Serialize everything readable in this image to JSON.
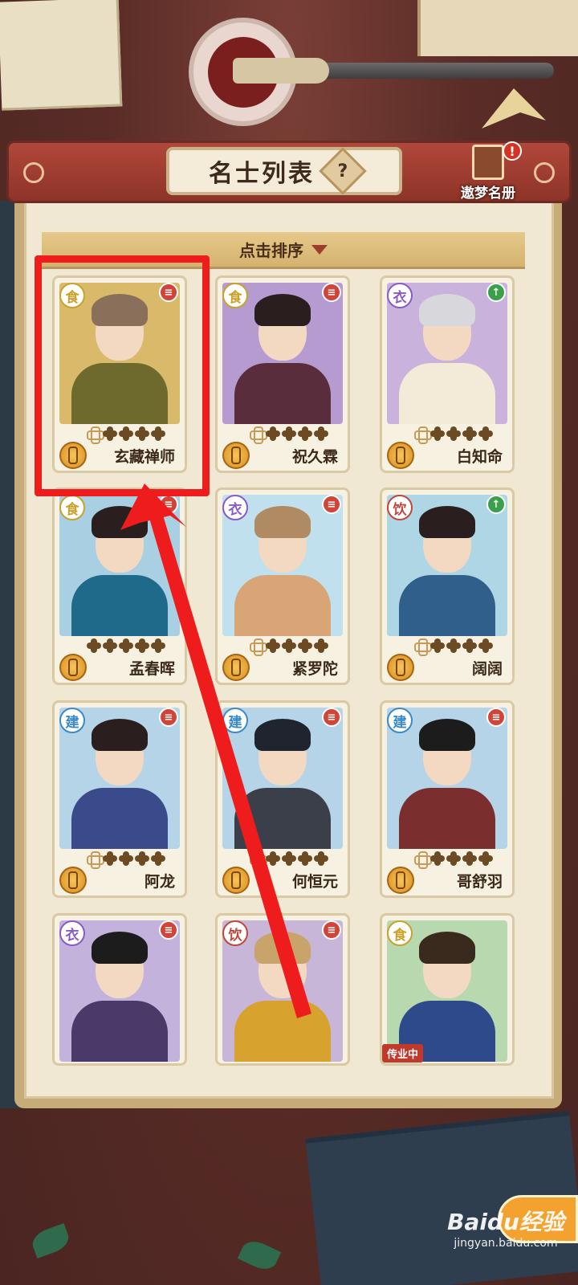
{
  "header": {
    "title": "名士列表",
    "help_label": "?",
    "dream_book_label": "遨梦名册",
    "alert_label": "!"
  },
  "sort": {
    "label": "点击排序"
  },
  "cards": [
    {
      "name": "玄藏禅师",
      "category": "食",
      "category_color": "#c9a22c",
      "badge": "red",
      "stars": 1,
      "bg": "#d9b96a",
      "hair": "#8a6f5a",
      "outfit": "#6e6a2e",
      "highlighted": true
    },
    {
      "name": "祝久霖",
      "category": "食",
      "category_color": "#c9a22c",
      "badge": "red",
      "stars": 1,
      "bg": "#b59bd0",
      "hair": "#2a1e1e",
      "outfit": "#5a2d3c"
    },
    {
      "name": "白知命",
      "category": "衣",
      "category_color": "#8a5bc4",
      "badge": "green",
      "stars": 1,
      "bg": "#c9b2dc",
      "hair": "#d8d8dc",
      "outfit": "#f3ead8"
    },
    {
      "name": "孟春晖",
      "category": "食",
      "category_color": "#c9a22c",
      "badge": "red",
      "stars": 0,
      "bg": "#a9d0e2",
      "hair": "#2a1e1e",
      "outfit": "#1f6a8a"
    },
    {
      "name": "紧罗陀",
      "category": "衣",
      "category_color": "#8a5bc4",
      "badge": "red",
      "stars": 1,
      "bg": "#bfe0ec",
      "hair": "#b08a63",
      "outfit": "#d9a577"
    },
    {
      "name": "阔阔",
      "category": "饮",
      "category_color": "#c0473b",
      "badge": "green",
      "stars": 1,
      "bg": "#aed6e4",
      "hair": "#2a1e1e",
      "outfit": "#2f5f8a"
    },
    {
      "name": "阿龙",
      "category": "建",
      "category_color": "#3a8ac8",
      "badge": "red",
      "stars": 1,
      "bg": "#b5d4e8",
      "hair": "#2a1e1e",
      "outfit": "#3b4a8a"
    },
    {
      "name": "何恒元",
      "category": "建",
      "category_color": "#3a8ac8",
      "badge": "red",
      "stars": 1,
      "bg": "#b5d4e8",
      "hair": "#20242e",
      "outfit": "#3b3f4a"
    },
    {
      "name": "哥舒羽",
      "category": "建",
      "category_color": "#3a8ac8",
      "badge": "red",
      "stars": 1,
      "bg": "#b5d4e8",
      "hair": "#1c1c1c",
      "outfit": "#7a2e2e"
    },
    {
      "name": "",
      "category": "衣",
      "category_color": "#8a5bc4",
      "badge": "red",
      "stars": 0,
      "bg": "#c3b3dc",
      "hair": "#1c1c1c",
      "outfit": "#4a3a6a"
    },
    {
      "name": "",
      "category": "饮",
      "category_color": "#c0473b",
      "badge": "red",
      "stars": 0,
      "bg": "#c8b6d8",
      "hair": "#c9a46a",
      "outfit": "#d8a22e"
    },
    {
      "name": "",
      "category": "食",
      "category_color": "#c9a22c",
      "badge": "none",
      "stars": 0,
      "bg": "#b8d8b0",
      "hair": "#3a2a1e",
      "outfit": "#2f4a8a",
      "status": "传业中"
    }
  ],
  "watermark": {
    "main": "Baidu经验",
    "url": "jingyan.baidu.com"
  }
}
